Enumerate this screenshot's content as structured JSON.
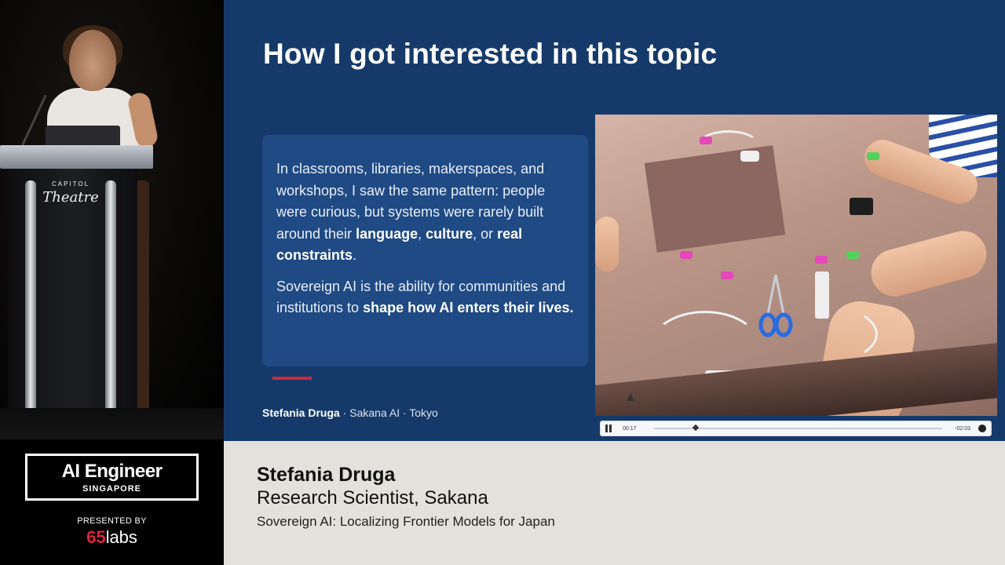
{
  "venue": {
    "podium_small": "CAPITOL",
    "podium_big": "Theatre"
  },
  "slide": {
    "title": "How I got interested in this topic",
    "paragraph1": {
      "part1": "In classrooms, libraries, makerspaces, and workshops, I saw the same pattern: people were curious, but systems were rarely built around their ",
      "bold1": "language",
      "part2": ", ",
      "bold2": "culture",
      "part3": ", or ",
      "bold3": "real constraints",
      "part4": "."
    },
    "paragraph2": {
      "part1": "Sovereign AI is the ability for communities and institutions to ",
      "bold1": "shape how AI enters their lives."
    },
    "byline_name": "Stefania Druga",
    "byline_rest": " · Sakana AI · Tokyo",
    "accent_color": "#d2283b"
  },
  "video": {
    "time_elapsed": "00:17",
    "time_remaining": "-02:03",
    "progress": 0.135
  },
  "event": {
    "title": "AI Engineer",
    "subtitle": "SINGAPORE",
    "presented_by": "PRESENTED BY",
    "sponsor_num": "65",
    "sponsor_word": "labs"
  },
  "lower_third": {
    "name": "Stefania Druga",
    "role": "Research Scientist, Sakana",
    "talk": "Sovereign AI: Localizing Frontier Models for Japan"
  }
}
